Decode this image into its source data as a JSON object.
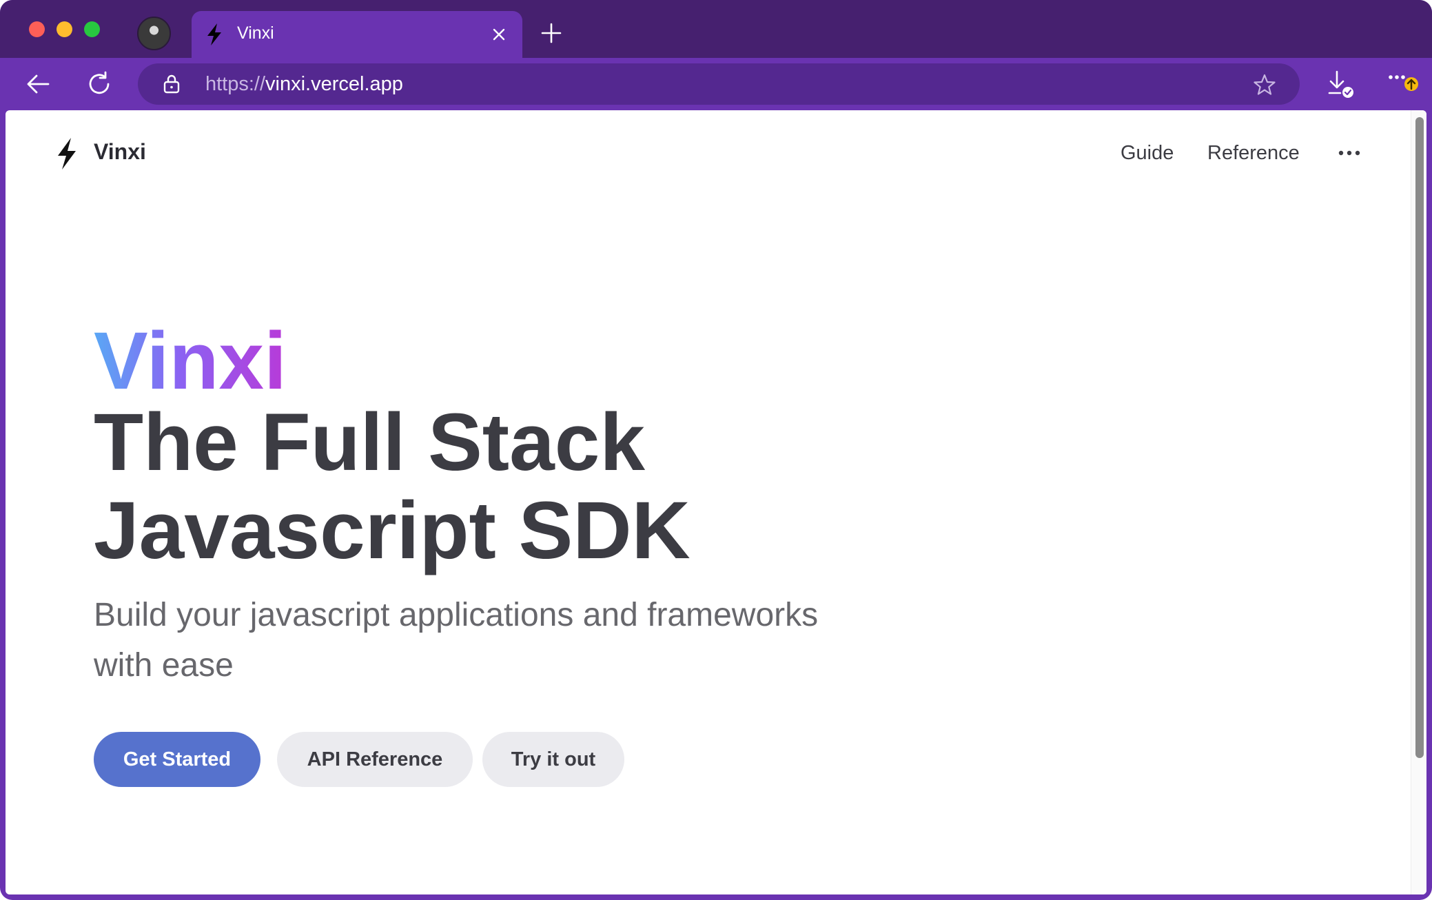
{
  "browser": {
    "tab": {
      "title": "Vinxi",
      "favicon": "lightning-bolt-icon"
    },
    "url": {
      "scheme": "https://",
      "host": "vinxi.vercel.app"
    },
    "icons": {
      "back": "arrow-left-icon",
      "reload": "reload-icon",
      "lock": "lock-icon",
      "star": "star-icon",
      "download": "download-icon",
      "menu": "more-horizontal-icon",
      "new_tab": "plus-icon",
      "close_tab": "close-icon"
    },
    "colors": {
      "frame": "#6a33b1",
      "tabbar": "#46206f",
      "omnibox": "#542890"
    }
  },
  "site": {
    "name": "Vinxi",
    "nav": {
      "guide": "Guide",
      "reference": "Reference"
    },
    "hero": {
      "name": "Vinxi",
      "title_line1": "The Full Stack",
      "title_line2": "Javascript SDK",
      "tagline_line1": "Build your javascript applications and frameworks",
      "tagline_line2": "with ease"
    },
    "actions": {
      "primary": "Get Started",
      "api_reference": "API Reference",
      "try_it": "Try it out"
    },
    "colors": {
      "brand": "#5672cd",
      "heading": "#3c3c43",
      "gradient_start": "#5aa7f5",
      "gradient_end": "#b83ad8"
    }
  }
}
